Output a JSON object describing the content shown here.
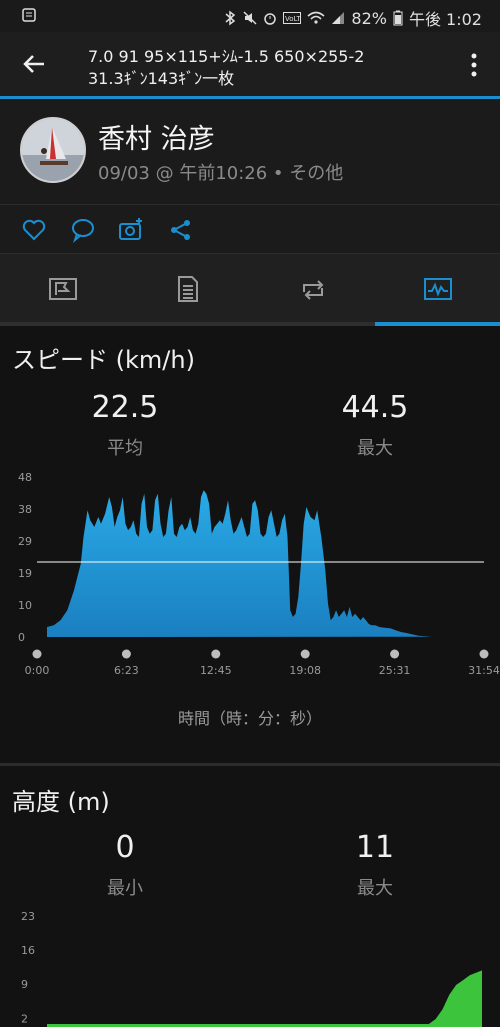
{
  "status_bar": {
    "battery": "82%",
    "time": "午後 1:02"
  },
  "header": {
    "line1": "7.0 91 95×115+ｼﾑ-1.5 650×255-2",
    "line2": "31.3ｷﾞﾝ143ｷﾞﾝ一枚"
  },
  "profile": {
    "name": "香村 治彦",
    "subtitle": "09/03 @ 午前10:26 • その他"
  },
  "speed": {
    "title": "スピード (km/h)",
    "avg_value": "22.5",
    "avg_label": "平均",
    "max_value": "44.5",
    "max_label": "最大",
    "time_axis_label": "時間（時：分：秒）"
  },
  "altitude": {
    "title": "高度 (m)",
    "min_value": "0",
    "min_label": "最小",
    "max_value": "11",
    "max_label": "最大"
  },
  "colors": {
    "accent": "#1a8fd0",
    "speed_fill": "#1e9ad8",
    "altitude_fill": "#3cc43c"
  },
  "chart_data": [
    {
      "type": "area",
      "y_ticks": [
        "0",
        "10",
        "19",
        "29",
        "38",
        "48"
      ],
      "x_ticks": [
        "0:00",
        "6:23",
        "12:45",
        "19:08",
        "25:31",
        "31:54"
      ],
      "ylim": [
        0,
        48
      ],
      "xlim_minutes": [
        0,
        31.9
      ],
      "average_line": 22.5,
      "x": [
        0,
        0.5,
        1,
        1.5,
        2,
        2.5,
        2.7,
        3,
        3.2,
        3.5,
        3.8,
        4,
        4.3,
        4.6,
        4.8,
        5,
        5.2,
        5.4,
        5.6,
        5.8,
        6,
        6.2,
        6.4,
        6.6,
        6.8,
        7,
        7.2,
        7.4,
        7.6,
        7.8,
        8,
        8.2,
        8.4,
        8.6,
        8.8,
        9,
        9.2,
        9.4,
        9.6,
        9.8,
        10,
        10.2,
        10.4,
        10.6,
        10.8,
        11,
        11.2,
        11.4,
        11.6,
        11.8,
        12,
        12.2,
        12.4,
        12.6,
        12.8,
        13,
        13.2,
        13.4,
        13.6,
        13.8,
        14,
        14.2,
        14.4,
        14.6,
        14.8,
        15,
        15.2,
        15.4,
        15.6,
        15.8,
        16,
        16.2,
        16.4,
        16.6,
        16.8,
        17,
        17.2,
        17.4,
        17.6,
        17.8,
        18,
        18.2,
        18.4,
        18.6,
        18.8,
        19,
        19.2,
        19.5,
        19.8,
        20,
        20.3,
        20.6,
        20.8,
        21,
        21.2,
        21.4,
        21.6,
        21.8,
        22,
        22.2,
        22.4,
        22.6,
        22.8,
        23,
        23.2,
        23.4,
        23.6,
        23.8,
        24,
        24.3,
        24.6,
        25,
        25.4,
        25.8,
        26.2,
        26.6,
        27,
        27.5,
        28,
        28.5,
        29,
        29.5,
        30,
        30.5,
        31,
        31.5,
        31.9
      ],
      "values": [
        3,
        3.5,
        5,
        8,
        14,
        22,
        30,
        38,
        35,
        33,
        36,
        34,
        37,
        42,
        39,
        33,
        36,
        38,
        42,
        34,
        32,
        33,
        35,
        31,
        30,
        40,
        43,
        33,
        31,
        32,
        41,
        43,
        34,
        30,
        31,
        38,
        42,
        31,
        30,
        33,
        34,
        32,
        33,
        36,
        32,
        31,
        34,
        42,
        44,
        43,
        40,
        31,
        33,
        34,
        35,
        34,
        37,
        41,
        35,
        31,
        32,
        34,
        36,
        33,
        30,
        31,
        40,
        41,
        38,
        31,
        30,
        31,
        36,
        38,
        34,
        30,
        31,
        35,
        37,
        30,
        8,
        6,
        7,
        12,
        22,
        34,
        39,
        36,
        35,
        38,
        30,
        20,
        10,
        5,
        6,
        8,
        6,
        7,
        8,
        6,
        9,
        6,
        7,
        6,
        5,
        6,
        5,
        4,
        3.5,
        3.5,
        3,
        2.8,
        2.6,
        2,
        1.5,
        1.2,
        0.8,
        0.4,
        0.2,
        0.1,
        0.1,
        0.1,
        0.1
      ]
    },
    {
      "type": "area",
      "y_ticks": [
        "2",
        "9",
        "16",
        "23"
      ],
      "series_visible_partial": true,
      "ylim": [
        0,
        23
      ],
      "x": [
        0,
        1,
        2,
        3,
        4,
        5,
        6,
        7,
        8,
        9,
        10,
        11,
        12,
        13,
        14,
        15,
        16,
        17,
        18,
        19,
        20,
        21,
        22,
        23,
        24,
        25,
        26,
        27,
        28,
        28.5,
        29,
        29.5,
        30,
        30.5,
        31,
        31.9
      ],
      "values": [
        0,
        0,
        0,
        0,
        0,
        0,
        0,
        0,
        0,
        0,
        0,
        0,
        0,
        0,
        0,
        0,
        0,
        0,
        0,
        0,
        0,
        0,
        0,
        0,
        0,
        0,
        0,
        0,
        0,
        1,
        3,
        6,
        8,
        9,
        10,
        11
      ]
    }
  ]
}
